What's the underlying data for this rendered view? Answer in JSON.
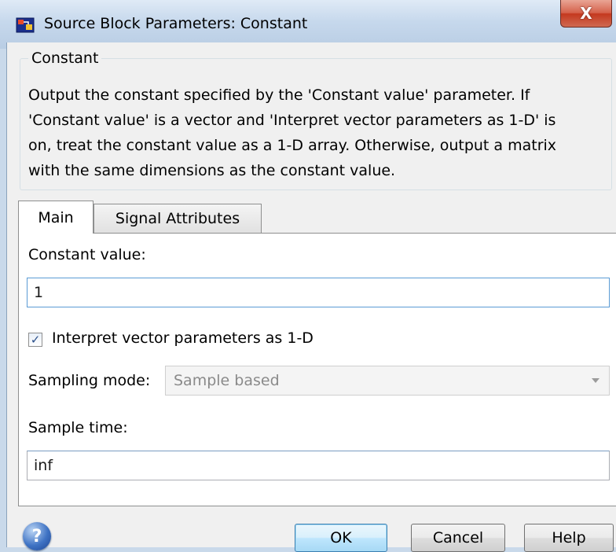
{
  "window": {
    "title": "Source Block Parameters: Constant",
    "close_glyph": "X"
  },
  "group": {
    "legend": "Constant",
    "description": "Output the constant specified by the 'Constant value' parameter. If\n'Constant value' is a vector and 'Interpret vector parameters as 1-D' is\non, treat the constant value as a 1-D array. Otherwise, output a matrix\nwith the same dimensions as the constant value."
  },
  "tabs": [
    {
      "label": "Main",
      "active": true
    },
    {
      "label": "Signal Attributes",
      "active": false
    }
  ],
  "main": {
    "constant_value_label": "Constant value:",
    "constant_value": "1",
    "interpret_label": "Interpret vector parameters as 1-D",
    "interpret_checked": true,
    "sampling_mode_label": "Sampling mode:",
    "sampling_mode_value": "Sample based",
    "sample_time_label": "Sample time:",
    "sample_time_value": "inf"
  },
  "buttons": {
    "help_icon": "?",
    "ok": "OK",
    "cancel": "Cancel",
    "help": "Help"
  },
  "icons": {
    "app": "simulink-block-icon",
    "help": "help-icon",
    "close": "close-icon",
    "checkbox": "checkmark-icon",
    "dropdown": "chevron-down-icon"
  },
  "colors": {
    "title_bar": "#c6d8ec",
    "close_button": "#c4391f",
    "dialog_bg": "#f0f0f0",
    "default_button": "#bee6fd",
    "active_field_border": "#5b9bd5"
  }
}
